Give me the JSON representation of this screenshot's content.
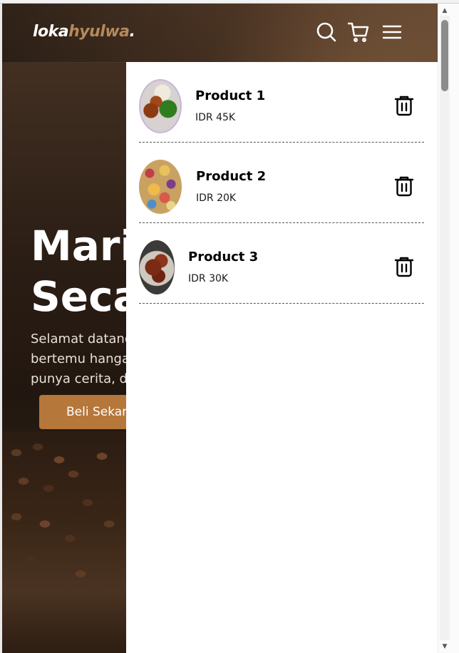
{
  "navbar": {
    "logo_part1": "loka",
    "logo_part2": "hyulwa",
    "logo_dot": ".",
    "icons": [
      "search-icon",
      "cart-icon",
      "menu-icon"
    ]
  },
  "hero": {
    "title_line1": "Mari",
    "title_line2": "Seca",
    "description": "Selamat datang bertemu hangat punya cerita, da",
    "description_lines": [
      "Selamat datang",
      "bertemu hangat",
      "punya cerita, da"
    ],
    "cta_label": "Beli Sekara"
  },
  "cart": {
    "items": [
      {
        "name": "Product 1",
        "price": "IDR 45K",
        "thumb": "food-1"
      },
      {
        "name": "Product 2",
        "price": "IDR 20K",
        "thumb": "food-2"
      },
      {
        "name": "Product 3",
        "price": "IDR 30K",
        "thumb": "food-3"
      }
    ],
    "delete_icon": "trash-icon"
  },
  "colors": {
    "accent": "#b6773a",
    "logo_accent": "#b6895b",
    "panel_bg": "#ffffff"
  }
}
